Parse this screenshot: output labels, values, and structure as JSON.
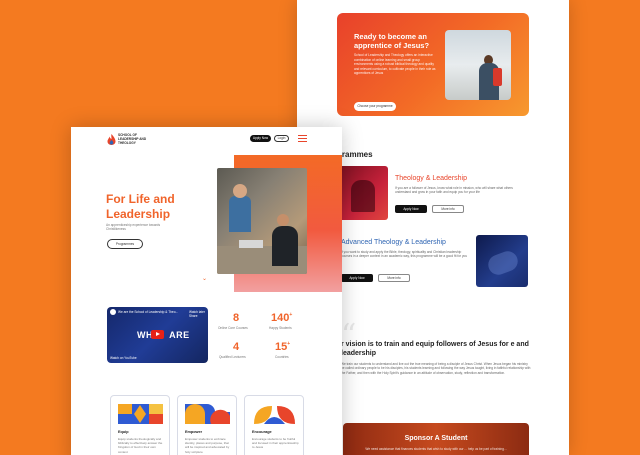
{
  "colors": {
    "background": "#f47a20",
    "accent": "#f0642b",
    "blue": "#2f65b3",
    "dark": "#111111"
  },
  "back_page": {
    "hero": {
      "title": "Ready to become an apprentice of Jesus?",
      "body": "School of Leadership and Theology offers an interactive combination of online learning and small group environments using a robust biblical theology and quality and relevant curriculum, to cultivate people in their role as apprentices of Jesus",
      "button": "Choose your programme"
    },
    "programmes": {
      "heading": "grammes",
      "items": [
        {
          "title": "Theology & Leadership",
          "text": "If you are a follower of Jesus, know what role in mission, who will share what others understand and grow in your faith and equip you for your life",
          "apply": "Apply Now",
          "more": "More info"
        },
        {
          "title": "Advanced Theology & Leadership",
          "text": "If you want to study and apply the Bible, theology, spirituality and Christian leadership courses in a deeper context in an academic way, this programme will be a good fit for you",
          "apply": "Apply Now",
          "more": "More info"
        }
      ]
    },
    "vision": {
      "quote_mark": "“",
      "heading": "r vision is to train and equip followers of Jesus for e and leadership",
      "text": "We train our students to understand and live out the true meaning of being a disciple of Jesus Christ. When Jesus began his ministry he called ordinary people to be his disciples, his students learning and following the way Jesus taught, living in faithful relationship with the Father, and then with the Holy Spirit's guidance in an attitude of observation, study, reflection and transformation."
    },
    "sponsor": {
      "title": "Sponsor A Student",
      "text": "We need assistance that finances students that wish to study with our ... help us be part of training..."
    }
  },
  "front_page": {
    "logo_text": "SCHOOL OF LEADERSHIP AND THEOLOGY",
    "nav": {
      "apply": "Apply Now",
      "login": "Login"
    },
    "hero": {
      "title": "For Life and Leadership",
      "subtitle": "An apprenticeship experience towards Christlikeness",
      "button": "Programmes"
    },
    "video": {
      "title": "We are the School of Leadership & Theo...",
      "share": "Watch later  Share",
      "big_text": "WHO   ARE",
      "footer": "Watch on YouTube"
    },
    "stats": [
      {
        "value": "8",
        "plus": "",
        "label": "Online Core Courses"
      },
      {
        "value": "140",
        "plus": "+",
        "label": "Happy Students"
      },
      {
        "value": "4",
        "plus": "",
        "label": "Qualified Lecturers"
      },
      {
        "value": "15",
        "plus": "+",
        "label": "Countries"
      }
    ],
    "cards": [
      {
        "title": "Equip",
        "text": "Equip students theologically and biblically to effectively answer the Kingdom of God in their own context"
      },
      {
        "title": "Empower",
        "text": "Empower students to embrace identity, places and purpose, that will be inspired and advocated by holy scripture"
      },
      {
        "title": "Encourage",
        "text": "Encourage students to be fruitful and focused in their apprenticeship to Jesus"
      }
    ]
  }
}
